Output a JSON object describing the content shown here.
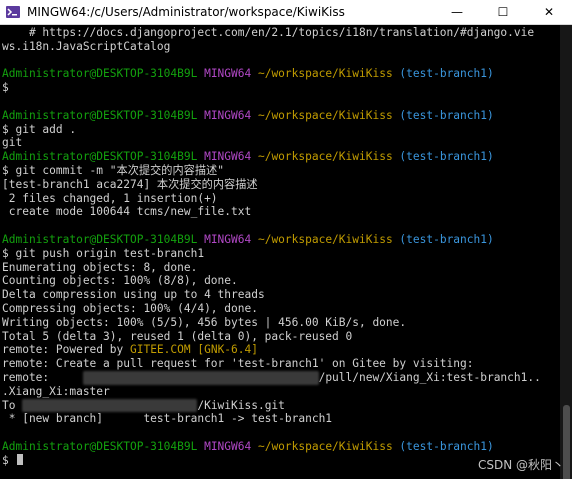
{
  "window": {
    "title": "MINGW64:/c/Users/Administrator/workspace/KiwiKiss",
    "controls": {
      "minimize": "—",
      "maximize": "☐",
      "close": "✕"
    }
  },
  "terminal": {
    "lines": [
      [
        {
          "t": "    # https://docs.djangoproject.com/en/2.1/topics/i18n/translation/#django.vie",
          "c": "w"
        }
      ],
      [
        {
          "t": "ws.i18n.JavaScriptCatalog",
          "c": "w"
        }
      ],
      [
        {
          "t": "",
          "c": "w"
        }
      ],
      [
        {
          "t": "Administrator@DESKTOP-3104B9L ",
          "c": "g"
        },
        {
          "t": "MINGW64 ",
          "c": "m"
        },
        {
          "t": "~/workspace/KiwiKiss ",
          "c": "y"
        },
        {
          "t": "(test-branch1)",
          "c": "c"
        }
      ],
      [
        {
          "t": "$",
          "c": "w"
        }
      ],
      [
        {
          "t": "",
          "c": "w"
        }
      ],
      [
        {
          "t": "Administrator@DESKTOP-3104B9L ",
          "c": "g"
        },
        {
          "t": "MINGW64 ",
          "c": "m"
        },
        {
          "t": "~/workspace/KiwiKiss ",
          "c": "y"
        },
        {
          "t": "(test-branch1)",
          "c": "c"
        }
      ],
      [
        {
          "t": "$ git add .",
          "c": "w"
        }
      ],
      [
        {
          "t": "git",
          "c": "w"
        }
      ],
      [
        {
          "t": "Administrator@DESKTOP-3104B9L ",
          "c": "g"
        },
        {
          "t": "MINGW64 ",
          "c": "m"
        },
        {
          "t": "~/workspace/KiwiKiss ",
          "c": "y"
        },
        {
          "t": "(test-branch1)",
          "c": "c"
        }
      ],
      [
        {
          "t": "$ git commit -m \"本次提交的内容描述\"",
          "c": "w"
        }
      ],
      [
        {
          "t": "[test-branch1 aca2274] 本次提交的内容描述",
          "c": "w"
        }
      ],
      [
        {
          "t": " 2 files changed, 1 insertion(+)",
          "c": "w"
        }
      ],
      [
        {
          "t": " create mode 100644 tcms/new_file.txt",
          "c": "w"
        }
      ],
      [
        {
          "t": "",
          "c": "w"
        }
      ],
      [
        {
          "t": "Administrator@DESKTOP-3104B9L ",
          "c": "g"
        },
        {
          "t": "MINGW64 ",
          "c": "m"
        },
        {
          "t": "~/workspace/KiwiKiss ",
          "c": "y"
        },
        {
          "t": "(test-branch1)",
          "c": "c"
        }
      ],
      [
        {
          "t": "$ git push origin test-branch1",
          "c": "w"
        }
      ],
      [
        {
          "t": "Enumerating objects: 8, done.",
          "c": "w"
        }
      ],
      [
        {
          "t": "Counting objects: 100% (8/8), done.",
          "c": "w"
        }
      ],
      [
        {
          "t": "Delta compression using up to 4 threads",
          "c": "w"
        }
      ],
      [
        {
          "t": "Compressing objects: 100% (4/4), done.",
          "c": "w"
        }
      ],
      [
        {
          "t": "Writing objects: 100% (5/5), 456 bytes | 456.00 KiB/s, done.",
          "c": "w"
        }
      ],
      [
        {
          "t": "Total 5 (delta 3), reused 1 (delta 0), pack-reused 0",
          "c": "w"
        }
      ],
      [
        {
          "t": "remote: Powered by ",
          "c": "w"
        },
        {
          "t": "GITEE.COM",
          "c": "y"
        },
        {
          "t": " ",
          "c": "w"
        },
        {
          "t": "[GNK-6.4]",
          "c": "y"
        }
      ],
      [
        {
          "t": "remote: Create a pull request for 'test-branch1' on Gitee by visiting:",
          "c": "w"
        }
      ],
      [
        {
          "t": "remote:     ",
          "c": "w"
        },
        {
          "t": "https://gitee.com/Xiang_Xi/KiwiKiss",
          "c": "w",
          "blur": true
        },
        {
          "t": "/pull/new/Xiang_Xi:test-branch1..",
          "c": "w"
        }
      ],
      [
        {
          "t": ".Xiang_Xi:master",
          "c": "w"
        }
      ],
      [
        {
          "t": "To ",
          "c": "w"
        },
        {
          "t": "https://gitee.com/Xiang_Xi",
          "c": "w",
          "blur": true
        },
        {
          "t": "/KiwiKiss.git",
          "c": "w"
        }
      ],
      [
        {
          "t": " * [new branch]      test-branch1 -> test-branch1",
          "c": "w"
        }
      ],
      [
        {
          "t": "",
          "c": "w"
        }
      ],
      [
        {
          "t": "Administrator@DESKTOP-3104B9L ",
          "c": "g"
        },
        {
          "t": "MINGW64 ",
          "c": "m"
        },
        {
          "t": "~/workspace/KiwiKiss ",
          "c": "y"
        },
        {
          "t": "(test-branch1)",
          "c": "c"
        }
      ],
      [
        {
          "t": "$ ",
          "c": "w"
        }
      ]
    ]
  },
  "watermark": "CSDN @秋阳丶",
  "colors": {
    "background": "#000000",
    "user_host": "#13a10e",
    "shell": "#b148c6",
    "path": "#c19c00",
    "branch": "#3a96dd",
    "text": "#c0c0c0"
  },
  "icons": {
    "app": "mingw-terminal-icon",
    "minimize": "minimize-icon",
    "maximize": "maximize-icon",
    "close": "close-icon"
  }
}
